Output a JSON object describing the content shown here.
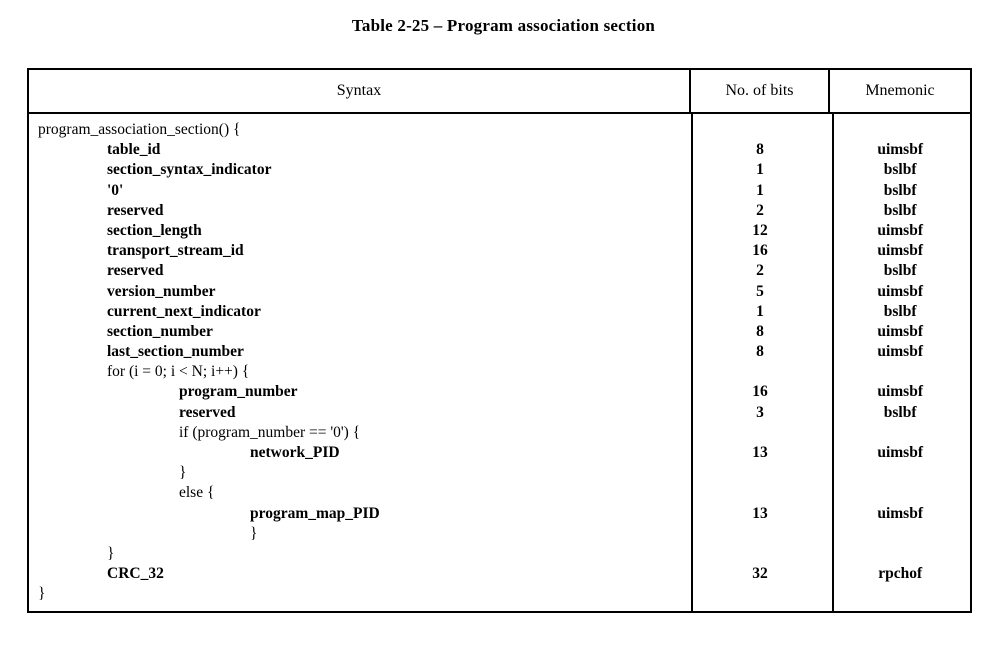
{
  "document": {
    "caption": "Table 2-25 – Program association section",
    "colors": {
      "text": "#000000",
      "background": "#ffffff",
      "rule": "#000000"
    }
  },
  "table": {
    "headers": {
      "syntax": "Syntax",
      "bits": "No. of bits",
      "mnemonic": "Mnemonic"
    },
    "rows": [
      {
        "syntax": "program_association_section() {",
        "indent": 0,
        "bold": false,
        "bits": "",
        "mnemonic": ""
      },
      {
        "syntax": "table_id",
        "indent": 1,
        "bold": true,
        "bits": "8",
        "mnemonic": "uimsbf"
      },
      {
        "syntax": "section_syntax_indicator",
        "indent": 1,
        "bold": true,
        "bits": "1",
        "mnemonic": "bslbf"
      },
      {
        "syntax": "'0'",
        "indent": 1,
        "bold": true,
        "bits": "1",
        "mnemonic": "bslbf"
      },
      {
        "syntax": "reserved",
        "indent": 1,
        "bold": true,
        "bits": "2",
        "mnemonic": "bslbf"
      },
      {
        "syntax": "section_length",
        "indent": 1,
        "bold": true,
        "bits": "12",
        "mnemonic": "uimsbf"
      },
      {
        "syntax": "transport_stream_id",
        "indent": 1,
        "bold": true,
        "bits": "16",
        "mnemonic": "uimsbf"
      },
      {
        "syntax": "reserved",
        "indent": 1,
        "bold": true,
        "bits": "2",
        "mnemonic": "bslbf"
      },
      {
        "syntax": "version_number",
        "indent": 1,
        "bold": true,
        "bits": "5",
        "mnemonic": "uimsbf"
      },
      {
        "syntax": "current_next_indicator",
        "indent": 1,
        "bold": true,
        "bits": "1",
        "mnemonic": "bslbf"
      },
      {
        "syntax": "section_number",
        "indent": 1,
        "bold": true,
        "bits": "8",
        "mnemonic": "uimsbf"
      },
      {
        "syntax": "last_section_number",
        "indent": 1,
        "bold": true,
        "bits": "8",
        "mnemonic": "uimsbf"
      },
      {
        "syntax": "for (i = 0; i < N; i++) {",
        "indent": 1,
        "bold": false,
        "bits": "",
        "mnemonic": ""
      },
      {
        "syntax": "program_number",
        "indent": 2,
        "bold": true,
        "bits": "16",
        "mnemonic": "uimsbf"
      },
      {
        "syntax": "reserved",
        "indent": 2,
        "bold": true,
        "bits": "3",
        "mnemonic": "bslbf"
      },
      {
        "syntax": "if (program_number == '0') {",
        "indent": 2,
        "bold": false,
        "bits": "",
        "mnemonic": ""
      },
      {
        "syntax": "network_PID",
        "indent": 3,
        "bold": true,
        "bits": "13",
        "mnemonic": "uimsbf"
      },
      {
        "syntax": "}",
        "indent": 2,
        "bold": false,
        "bits": "",
        "mnemonic": ""
      },
      {
        "syntax": "else {",
        "indent": 2,
        "bold": false,
        "bits": "",
        "mnemonic": ""
      },
      {
        "syntax": "program_map_PID",
        "indent": 3,
        "bold": true,
        "bits": "13",
        "mnemonic": "uimsbf"
      },
      {
        "syntax": "}",
        "indent": 3,
        "bold": false,
        "bits": "",
        "mnemonic": ""
      },
      {
        "syntax": "}",
        "indent": 1,
        "bold": false,
        "bits": "",
        "mnemonic": ""
      },
      {
        "syntax": "CRC_32",
        "indent": 1,
        "bold": true,
        "bits": "32",
        "mnemonic": "rpchof"
      },
      {
        "syntax": "}",
        "indent": 0,
        "bold": false,
        "bits": "",
        "mnemonic": ""
      }
    ]
  }
}
